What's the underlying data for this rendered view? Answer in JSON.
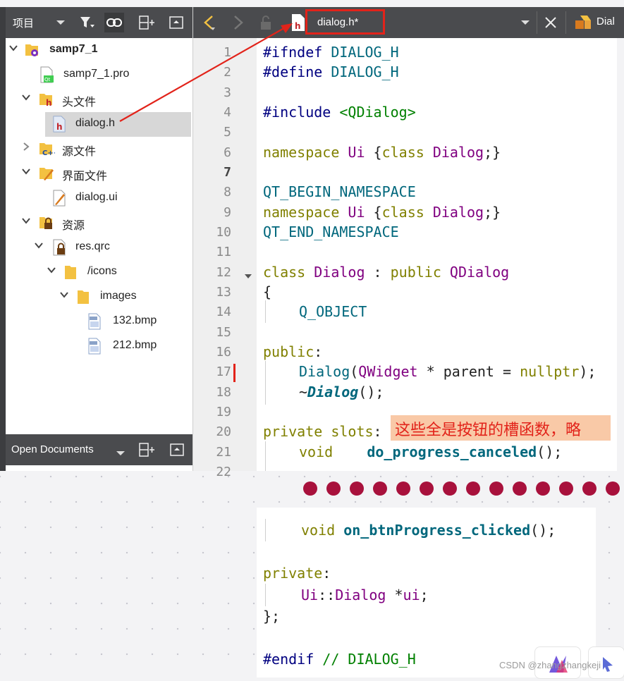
{
  "project_panel": {
    "title": "项目",
    "tree": [
      {
        "label": "samp7_1",
        "bold": true
      },
      {
        "label": "samp7_1.pro"
      },
      {
        "label": "头文件"
      },
      {
        "label": "dialog.h",
        "selected": true
      },
      {
        "label": "源文件"
      },
      {
        "label": "界面文件"
      },
      {
        "label": "dialog.ui"
      },
      {
        "label": "资源"
      },
      {
        "label": "res.qrc"
      },
      {
        "label": "/icons"
      },
      {
        "label": "images"
      },
      {
        "label": "132.bmp"
      },
      {
        "label": "212.bmp"
      }
    ]
  },
  "open_documents": {
    "title": "Open Documents"
  },
  "editor": {
    "file_tab": "dialog.h*",
    "right_tab": "Dial",
    "line_numbers": [
      "1",
      "2",
      "3",
      "4",
      "5",
      "6",
      "7",
      "8",
      "9",
      "10",
      "11",
      "12",
      "13",
      "14",
      "15",
      "16",
      "17",
      "18",
      "19",
      "20",
      "21",
      "22"
    ],
    "current_line": "7",
    "lines": {
      "l1": {
        "a": "#ifndef",
        "b": " DIALOG_H"
      },
      "l2": {
        "a": "#define",
        "b": " DIALOG_H"
      },
      "l4": {
        "a": "#include",
        "b": " <QDialog>"
      },
      "l6": {
        "a": "namespace",
        "b": " Ui ",
        "c": "{",
        "d": "class",
        "e": " Dialog",
        "f": ";}"
      },
      "l8": {
        "a": "QT_BEGIN_NAMESPACE"
      },
      "l9": {
        "a": "namespace",
        "b": " Ui ",
        "c": "{",
        "d": "class",
        "e": " Dialog",
        "f": ";}"
      },
      "l10": {
        "a": "QT_END_NAMESPACE"
      },
      "l12": {
        "a": "class",
        "b": " Dialog",
        "c": " : ",
        "d": "public",
        "e": " QDialog"
      },
      "l13": {
        "a": "{"
      },
      "l14": {
        "a": "Q_OBJECT"
      },
      "l16": {
        "a": "public",
        "b": ":"
      },
      "l17": {
        "a": "Dialog",
        "b": "(",
        "c": "QWidget",
        "d": " * parent = ",
        "e": "nullptr",
        "f": ");"
      },
      "l18": {
        "a": "~",
        "b": "Dialog",
        "c": "();"
      },
      "l20": {
        "a": "private",
        "b": " slots",
        "c": ":"
      },
      "l21": {
        "a": "void",
        "b": "    do_progress_canceled",
        "c": "();"
      }
    },
    "annotation": "这些全是按钮的槽函数，略",
    "lines_cont": {
      "m1": {
        "a": "void",
        "b": " on_btnProgress_clicked",
        "c": "();"
      },
      "m3": {
        "a": "private",
        "b": ":"
      },
      "m4": {
        "a": "Ui",
        "b": "::",
        "c": "Dialog",
        "d": " *",
        "e": "ui",
        "f": ";"
      },
      "m5": {
        "a": "};"
      },
      "m7": {
        "a": "#endif",
        "b": " // DIALOG_H"
      }
    }
  },
  "watermark": "CSDN @zhangzhangkeji",
  "colors": {
    "tab_highlight": "#e2231a",
    "toolbar": "#4a4b4e",
    "dots": "#a8113c",
    "note_bg": "#f9c9a7"
  }
}
